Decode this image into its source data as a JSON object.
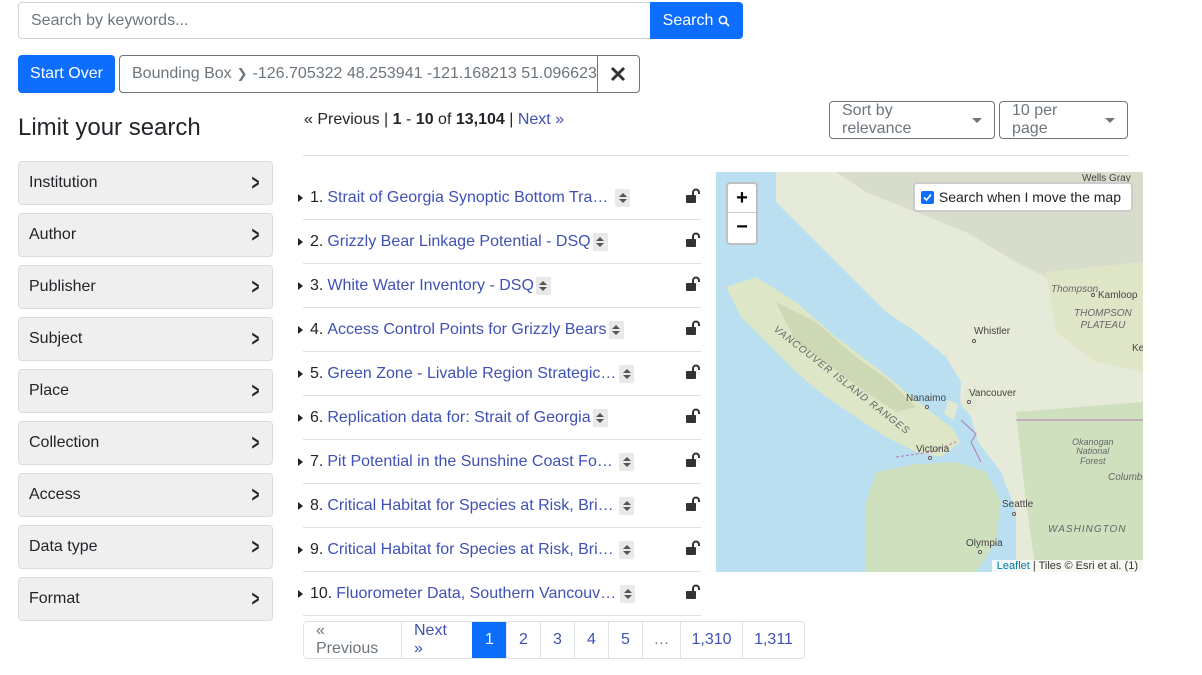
{
  "search": {
    "placeholder": "Search by keywords...",
    "button_label": "Search"
  },
  "start_over_label": "Start Over",
  "constraint": {
    "field": "Bounding Box",
    "value": "-126.705322 48.253941 -121.168213 51.096623"
  },
  "sidebar": {
    "heading": "Limit your search",
    "facets": [
      {
        "label": "Institution"
      },
      {
        "label": "Author"
      },
      {
        "label": "Publisher"
      },
      {
        "label": "Subject"
      },
      {
        "label": "Place"
      },
      {
        "label": "Collection"
      },
      {
        "label": "Access"
      },
      {
        "label": "Data type"
      },
      {
        "label": "Format"
      }
    ]
  },
  "paging": {
    "previous": "« Previous",
    "start": "1",
    "end": "10",
    "of": "of",
    "total": "13,104",
    "next": "Next »",
    "sep1": "|",
    "dash": "-",
    "sep2": "|"
  },
  "sort": {
    "sort_label": "Sort by relevance",
    "per_page_label": "10 per page"
  },
  "results": [
    {
      "num": "1.",
      "title": "Strait of Georgia Synoptic Bottom Trawl Survey"
    },
    {
      "num": "2.",
      "title": "Grizzly Bear Linkage Potential - DSQ"
    },
    {
      "num": "3.",
      "title": "White Water Inventory - DSQ"
    },
    {
      "num": "4.",
      "title": "Access Control Points for Grizzly Bears"
    },
    {
      "num": "5.",
      "title": "Green Zone - Livable Region Strategic Plan"
    },
    {
      "num": "6.",
      "title": "Replication data for: Strait of Georgia"
    },
    {
      "num": "7.",
      "title": "Pit Potential in the Sunshine Coast Forest District"
    },
    {
      "num": "8.",
      "title": "Critical Habitat for Species at Risk, British Columbia"
    },
    {
      "num": "9.",
      "title": "Critical Habitat for Species at Risk, British Columbia"
    },
    {
      "num": "10.",
      "title": "Fluorometer Data, Southern Vancouver Island"
    }
  ],
  "map": {
    "zoom_in": "+",
    "zoom_out": "−",
    "search_toggle_label": "Search when I move the map",
    "search_toggle_checked": true,
    "attribution_link": "Leaflet",
    "attribution_text": "| Tiles © Esri et al. (1)",
    "labels": {
      "wells_gray": "Wells Gray",
      "thompson": "Thompson",
      "kamloops": "Kamloop",
      "thompson_plateau": "THOMPSON\nPLATEAU",
      "whistler": "Whistler",
      "ke": "Ke",
      "vancouver_island_ranges": "VANCOUVER ISLAND RANGES",
      "nanaimo": "Nanaimo",
      "vancouver": "Vancouver",
      "victoria": "Victoria",
      "okanogan": "Okanogan\nNational\nForest",
      "columbia": "Columbi",
      "seattle": "Seattle",
      "washington": "WASHINGTON",
      "olympia": "Olympia"
    }
  },
  "pagination": [
    "« Previous",
    "Next »",
    "1",
    "2",
    "3",
    "4",
    "5",
    "…",
    "1,310",
    "1,311"
  ],
  "colors": {
    "primary": "#0d6efd",
    "link": "#3f51b5",
    "facet_bg": "#efefef"
  }
}
